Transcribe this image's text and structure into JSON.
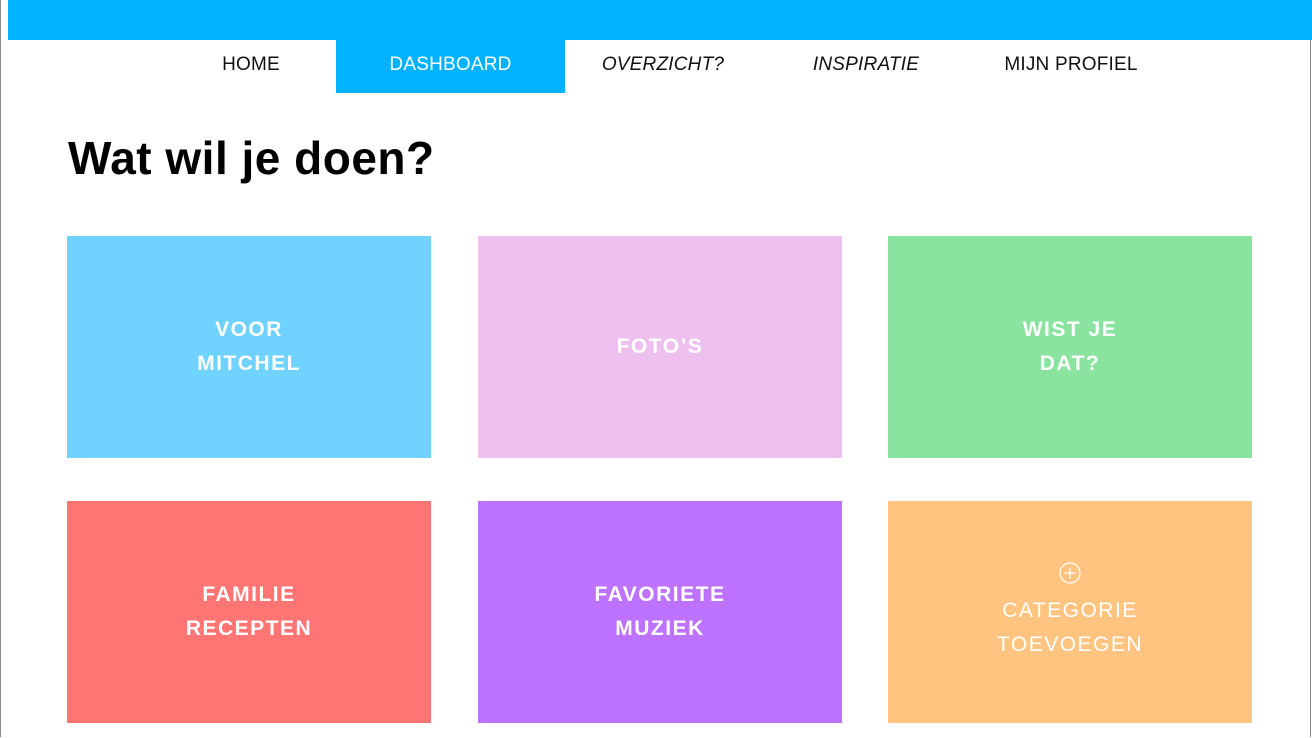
{
  "colors": {
    "accent": "#00b2ff",
    "tile_blue": "#70d3ff",
    "tile_pink": "#eec0f0",
    "tile_green": "#8ae39e",
    "tile_red": "#ff7573",
    "tile_purple": "#bd73ff",
    "tile_orange": "#ffc47f"
  },
  "nav": {
    "items": [
      {
        "label": "HOME",
        "active": false,
        "italic": false
      },
      {
        "label": "DASHBOARD",
        "active": true,
        "italic": false
      },
      {
        "label": "OVERZICHT?",
        "active": false,
        "italic": true
      },
      {
        "label": "INSPIRATIE",
        "active": false,
        "italic": true
      },
      {
        "label": "MIJN PROFIEL",
        "active": false,
        "italic": false
      }
    ]
  },
  "main": {
    "title": "Wat wil je doen?",
    "tiles": [
      {
        "label": "VOOR\nMITCHEL"
      },
      {
        "label": "FOTO’S"
      },
      {
        "label": "WIST JE\nDAT?"
      },
      {
        "label": "FAMILIE\nRECEPTEN"
      },
      {
        "label": "FAVORIETE\nMUZIEK"
      },
      {
        "label": "CATEGORIE\nTOEVOEGEN",
        "icon": "plus-circle-icon"
      }
    ]
  }
}
